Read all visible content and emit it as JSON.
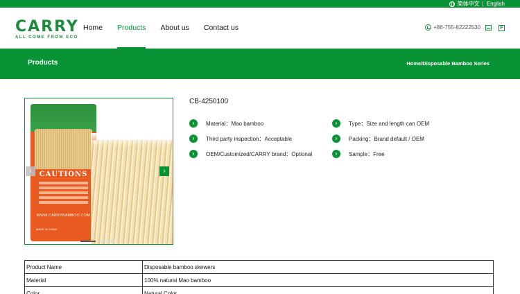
{
  "topbar": {
    "lang_cn": "简体中文",
    "separator": "|",
    "lang_en": "English"
  },
  "header": {
    "logo_word": "CARRY",
    "logo_tag": "ALL COME FROM ECO",
    "nav": [
      {
        "label": "Home",
        "active": false
      },
      {
        "label": "Products",
        "active": true
      },
      {
        "label": "About us",
        "active": false
      },
      {
        "label": "Contact us",
        "active": false
      }
    ],
    "phone": "+86-755-82222530",
    "icons": [
      "phone-icon",
      "mail-icon",
      "facebook-icon"
    ]
  },
  "banner": {
    "title": "Products",
    "breadcrumb": "Home/Disposable Bamboo Series"
  },
  "gallery": {
    "pack_heading": "CAUTIONS",
    "pack_url": "WWW.CARRYBAMBOO.COM",
    "pack_origin": "MADE IN CHINA",
    "prev_arrow": "‹",
    "next_arrow": "›",
    "slide_count": 2,
    "active_slide": 1
  },
  "product": {
    "code": "CB-4250100",
    "attributes": [
      {
        "label": "Material：Mao bamboo"
      },
      {
        "label": "Type：Size and length can OEM"
      },
      {
        "label": "Third party inspection：Acceptable"
      },
      {
        "label": "Packing：Brand default / OEM"
      },
      {
        "label": "OEM/Customized/CARRY brand：Optional"
      },
      {
        "label": "Sample：Free"
      }
    ],
    "bullet_glyph": "›"
  },
  "spec_table": {
    "rows": [
      {
        "key": "Product Name",
        "value": "Disposable  bamboo skewers"
      },
      {
        "key": "Material",
        "value": "100% natural Mao bamboo"
      },
      {
        "key": "Color",
        "value": "Natural Color"
      }
    ]
  },
  "colors": {
    "brand_green": "#0a9236",
    "logo_green": "#1f8a3e",
    "pack_orange": "#e85a1f"
  }
}
